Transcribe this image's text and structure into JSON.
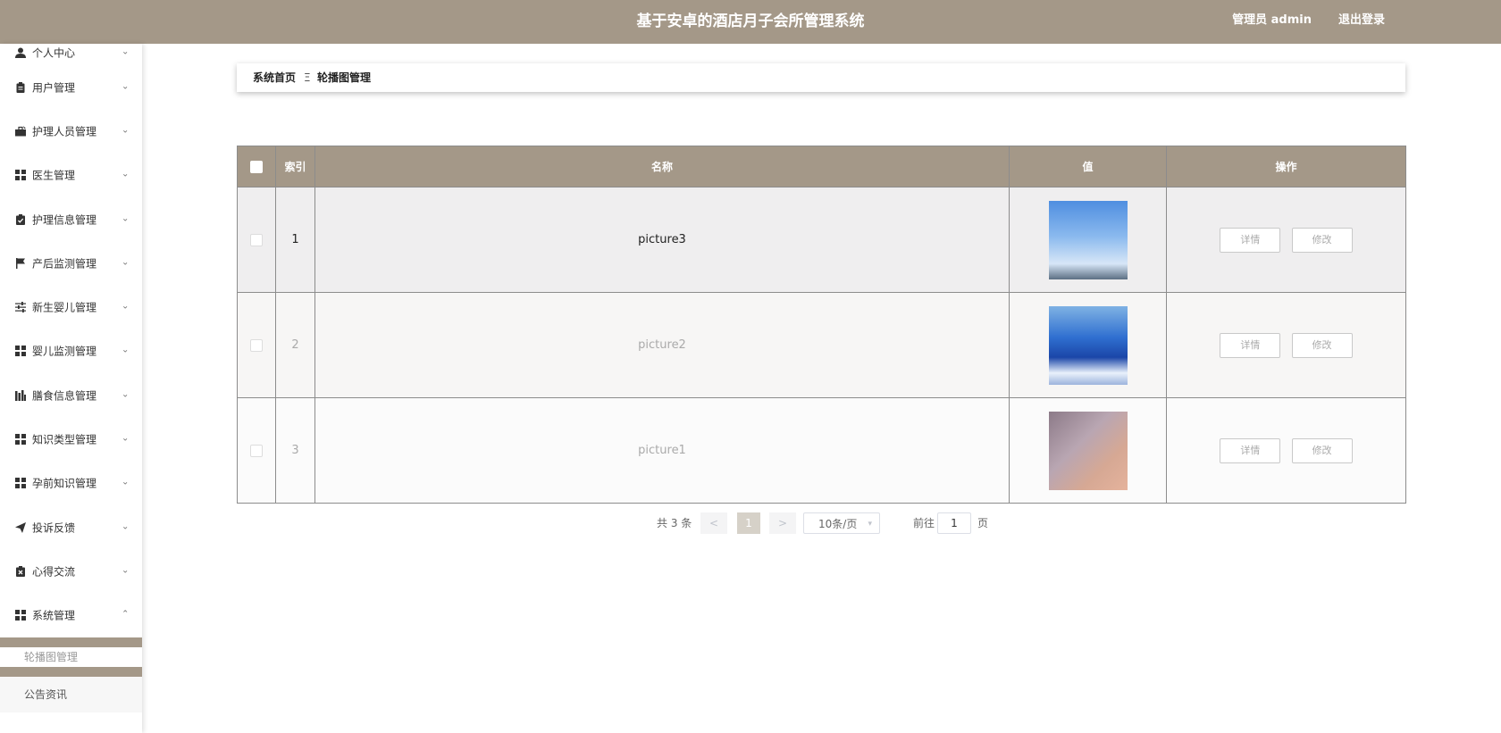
{
  "header": {
    "title": "基于安卓的酒店月子会所管理系统",
    "user_label": "管理员 admin",
    "logout_label": "退出登录"
  },
  "sidebar": {
    "items": [
      {
        "label": "个人中心",
        "icon": "user-icon"
      },
      {
        "label": "用户管理",
        "icon": "clipboard-icon"
      },
      {
        "label": "护理人员管理",
        "icon": "briefcase-icon"
      },
      {
        "label": "医生管理",
        "icon": "grid-icon"
      },
      {
        "label": "护理信息管理",
        "icon": "clipboard-check-icon"
      },
      {
        "label": "产后监测管理",
        "icon": "flag-icon"
      },
      {
        "label": "新生婴儿管理",
        "icon": "sliders-icon"
      },
      {
        "label": "婴儿监测管理",
        "icon": "grid-icon"
      },
      {
        "label": "膳食信息管理",
        "icon": "bar-chart-icon"
      },
      {
        "label": "知识类型管理",
        "icon": "grid-icon"
      },
      {
        "label": "孕前知识管理",
        "icon": "grid-icon"
      },
      {
        "label": "投诉反馈",
        "icon": "send-icon"
      },
      {
        "label": "心得交流",
        "icon": "clipboard-x-icon"
      },
      {
        "label": "系统管理",
        "icon": "grid-icon"
      }
    ],
    "submenu": [
      "轮播图管理",
      "公告资讯"
    ]
  },
  "breadcrumb": {
    "home": "系统首页",
    "separator": "Ξ",
    "current": "轮播图管理"
  },
  "table": {
    "headers": [
      "索引",
      "名称",
      "值",
      "操作"
    ],
    "rows": [
      {
        "index": "1",
        "name": "picture3",
        "image": "hot-air-balloons-sky"
      },
      {
        "index": "2",
        "name": "picture2",
        "image": "blue-water-scene"
      },
      {
        "index": "3",
        "name": "picture1",
        "image": "pink-blurred-photo"
      }
    ],
    "detail_label": "详情",
    "edit_label": "修改"
  },
  "pagination": {
    "total": "共 3 条",
    "prev": "<",
    "page": "1",
    "next": ">",
    "page_size": "10条/页",
    "goto_label": "前往",
    "goto_value": "1",
    "page_unit": "页"
  },
  "colors": {
    "theme": "#a49888",
    "border": "#8c8c8c"
  }
}
